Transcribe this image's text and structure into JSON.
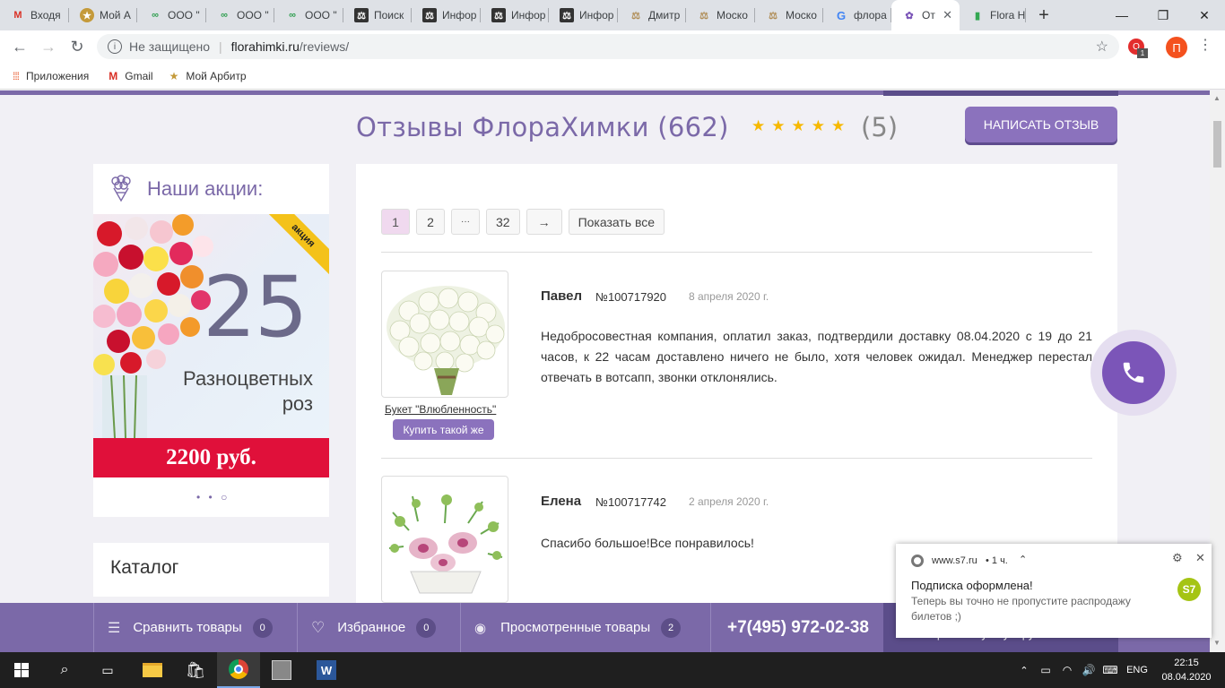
{
  "browser": {
    "tabs": [
      {
        "title": "Входя",
        "icon": "gmail-icon"
      },
      {
        "title": "Мой А",
        "icon": "arbitr-icon"
      },
      {
        "title": "ООО \"",
        "icon": "company-icon"
      },
      {
        "title": "ООО \"",
        "icon": "company-icon"
      },
      {
        "title": "ООО \"",
        "icon": "company-icon"
      },
      {
        "title": "Поиск",
        "icon": "law-icon"
      },
      {
        "title": "Инфор",
        "icon": "law-icon"
      },
      {
        "title": "Инфор",
        "icon": "law-icon"
      },
      {
        "title": "Инфор",
        "icon": "law-icon"
      },
      {
        "title": "Дмитр",
        "icon": "scales-icon"
      },
      {
        "title": "Моско",
        "icon": "scales-icon"
      },
      {
        "title": "Моско",
        "icon": "scales-icon"
      },
      {
        "title": "флора",
        "icon": "google-icon"
      },
      {
        "title": "От",
        "icon": "flora-icon",
        "active": true
      },
      {
        "title": "Flora H",
        "icon": "chart-icon"
      }
    ],
    "not_secure": "Не защищено",
    "url_host": "florahimki.ru",
    "url_path": "/reviews/",
    "bookmarks": [
      {
        "label": "Приложения",
        "icon": "apps-icon"
      },
      {
        "label": "Gmail",
        "icon": "gmail-icon"
      },
      {
        "label": "Мой Арбитр",
        "icon": "arbitr-icon"
      }
    ],
    "profile_letter": "П",
    "ext_badge": "1"
  },
  "header": {
    "title": "Отзывы ФлораХимки (662)",
    "stars": "★★★★★",
    "rating": "(5)",
    "write_button": "НАПИСАТЬ ОТЗЫВ"
  },
  "promo": {
    "title": "Наши акции:",
    "ribbon": "акция",
    "number": "25",
    "text_line1": "Разноцветных",
    "text_line2": "роз",
    "price": "2200 руб.",
    "dots": "• • ○"
  },
  "catalog": {
    "title": "Каталог"
  },
  "pager": {
    "pages": [
      "1",
      "2",
      "···",
      "32",
      "→"
    ],
    "show_all": "Показать все"
  },
  "reviews": [
    {
      "name": "Павел",
      "order": "№100717920",
      "date": "8 апреля 2020 г.",
      "text": "Недобросовестная компания, оплатил заказ, подтвердили доставку 08.04.2020 с 19 до 21 часов, к 22 часам доставлено ничего не было, хотя человек ожидал. Менеджер перестал отвечать в вотсапп, звонки отклонялись.",
      "product": "Букет \"Влюбленность\"",
      "buy": "Купить такой же"
    },
    {
      "name": "Елена",
      "order": "№100717742",
      "date": "2 апреля 2020 г.",
      "text": "Спасибо большое!Все понравилось!"
    }
  ],
  "bottombar": {
    "compare": "Сравнить товары",
    "compare_count": "0",
    "favorites": "Избранное",
    "favorites_count": "0",
    "viewed": "Просмотренные товары",
    "viewed_count": "2",
    "phone": "+7(495) 972-02-38",
    "hidden_text": "0 товаров на сумму 0 руб."
  },
  "notification": {
    "source": "www.s7.ru",
    "time": "• 1 ч.",
    "title": "Подписка оформлена!",
    "body": "Теперь вы точно не пропустите распродажу билетов ;)",
    "logo": "S7"
  },
  "taskbar": {
    "lang": "ENG",
    "time": "22:15",
    "date": "08.04.2020"
  }
}
